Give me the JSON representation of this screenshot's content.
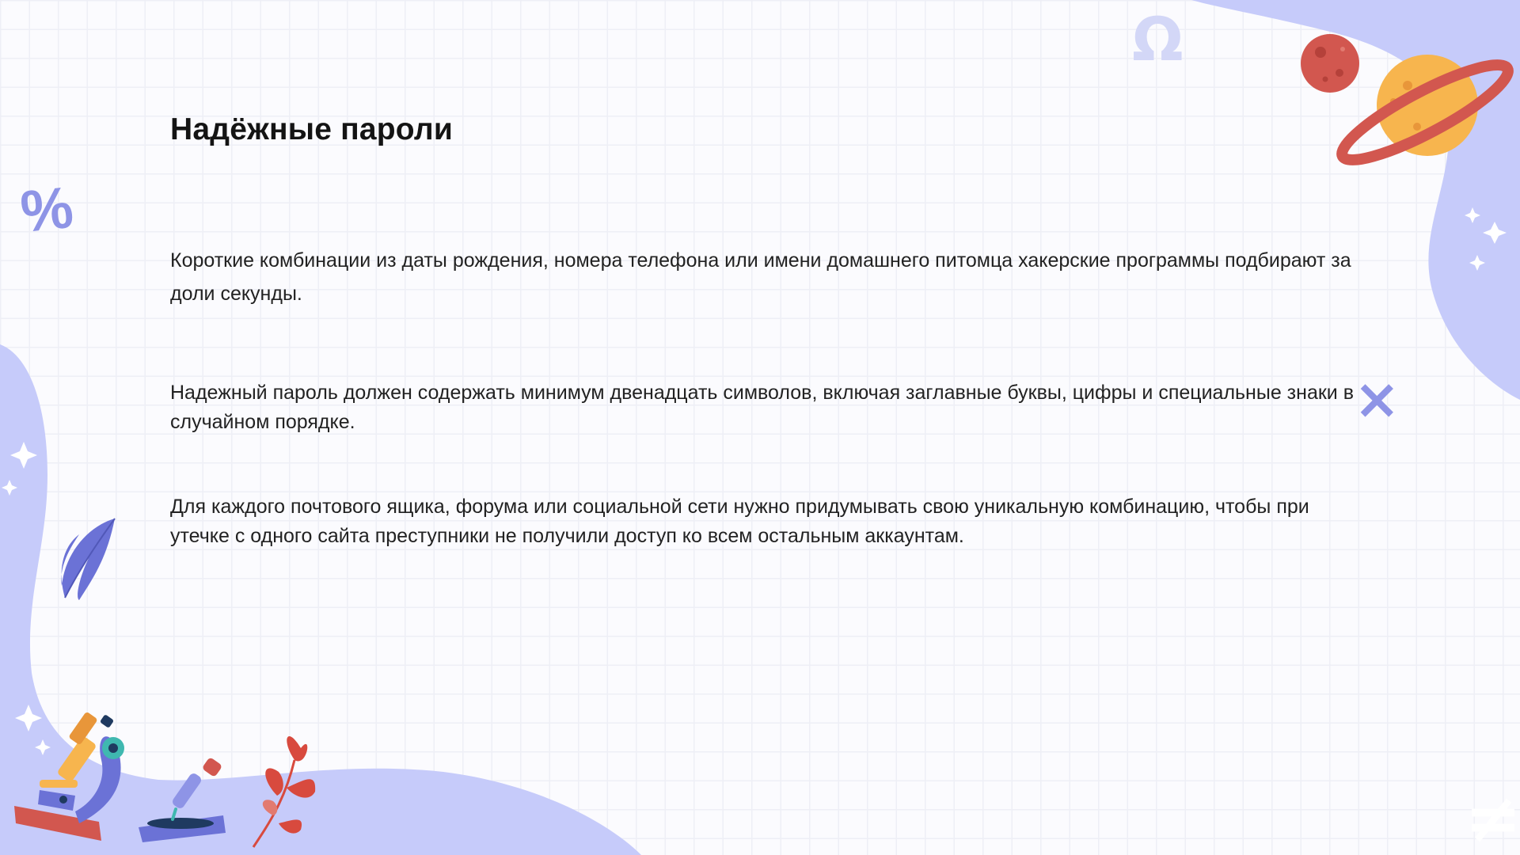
{
  "slide": {
    "title": "Надёжные пароли",
    "paragraphs": [
      "Короткие комбинации из даты рождения, номера телефона или имени домашнего питомца хакерские программы подбирают за доли секунды.",
      "Надежный пароль должен содержать минимум двенадцать символов, включая заглавные буквы, цифры и специальные знаки в случайном порядке.",
      "Для каждого почтового ящика, форума или социальной сети нужно придумывать свою уникальную комбинацию, чтобы при утечке с одного сайта преступники не получили доступ ко всем остальным аккаунтам."
    ]
  },
  "decorations": {
    "symbols": {
      "percent": "%",
      "omega": "Ω",
      "times": "×",
      "not_equal": "≠"
    },
    "icons": [
      "planet-red-icon",
      "saturn-icon",
      "leaf-icon",
      "microscope-icon",
      "pipette-icon",
      "red-plant-icon",
      "sparkle-icon"
    ]
  },
  "colors": {
    "blob": "#c6cbfa",
    "accent_purple": "#6b72d6",
    "symbol_purple": "#8e94e6",
    "planet_red": "#d2574f",
    "planet_orange": "#f7b54e",
    "leaf_red": "#d84a3e",
    "text": "#222222",
    "title": "#141414"
  }
}
